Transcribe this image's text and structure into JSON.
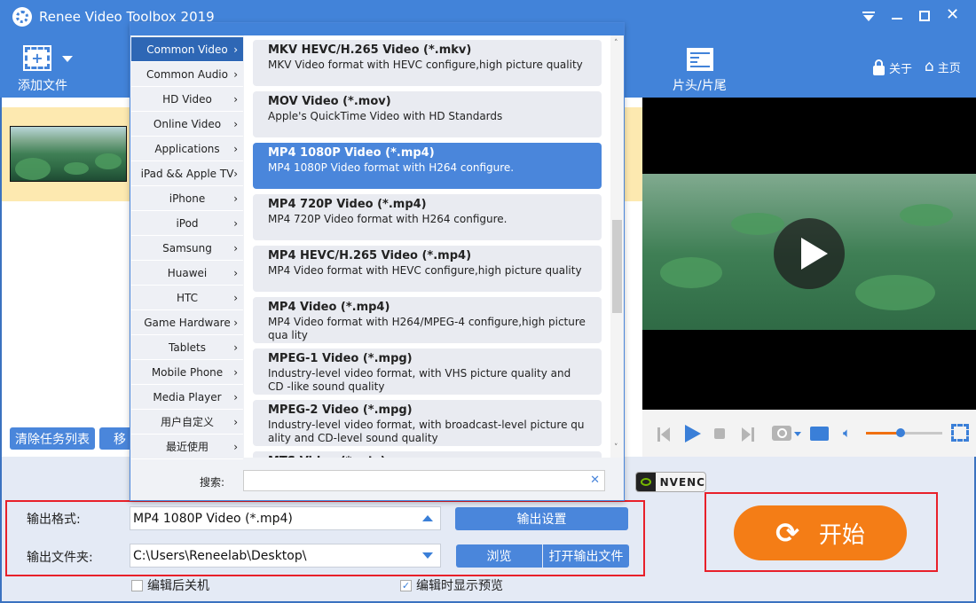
{
  "window": {
    "title": "Renee Video Toolbox 2019"
  },
  "toolbar": {
    "add_file": "添加文件",
    "head_tail": "片头/片尾",
    "about": "关于",
    "home": "主页"
  },
  "task_list": {
    "clear_button": "清除任务列表",
    "move_button": "移"
  },
  "format_popup": {
    "categories": [
      "Common Video",
      "Common Audio",
      "HD Video",
      "Online Video",
      "Applications",
      "iPad && Apple TV",
      "iPhone",
      "iPod",
      "Samsung",
      "Huawei",
      "HTC",
      "Game Hardware",
      "Tablets",
      "Mobile Phone",
      "Media Player",
      "用户自定义",
      "最近使用"
    ],
    "selected_category": "Common Video",
    "formats": [
      {
        "title": "MKV HEVC/H.265 Video (*.mkv)",
        "desc": "MKV Video format with HEVC configure,high picture quality"
      },
      {
        "title": "MOV Video (*.mov)",
        "desc": "Apple's QuickTime Video with HD Standards"
      },
      {
        "title": "MP4 1080P Video (*.mp4)",
        "desc": "MP4 1080P Video format with H264 configure."
      },
      {
        "title": "MP4 720P Video (*.mp4)",
        "desc": "MP4 720P Video format with H264 configure."
      },
      {
        "title": "MP4 HEVC/H.265 Video (*.mp4)",
        "desc": "MP4 Video format with HEVC configure,high picture quality"
      },
      {
        "title": "MP4 Video (*.mp4)",
        "desc": "MP4 Video format with H264/MPEG-4 configure,high picture qua lity"
      },
      {
        "title": "MPEG-1 Video (*.mpg)",
        "desc": "Industry-level video format, with VHS picture quality and CD -like sound quality"
      },
      {
        "title": "MPEG-2 Video (*.mpg)",
        "desc": "Industry-level video format, with broadcast-level picture qu ality and CD-level sound quality"
      },
      {
        "title": "MTS Video (*.mts)",
        "desc": ""
      }
    ],
    "selected_format": "MP4 1080P Video (*.mp4)",
    "search_label": "搜索:",
    "search_value": ""
  },
  "player": {
    "volume_percent": 45
  },
  "nvenc": "NVENC",
  "output": {
    "format_label": "输出格式:",
    "format_value": "MP4 1080P Video (*.mp4)",
    "settings_button": "输出设置",
    "folder_label": "输出文件夹:",
    "folder_value": "C:\\Users\\Reneelab\\Desktop\\",
    "browse_button": "浏览",
    "open_button": "打开输出文件"
  },
  "options": {
    "shutdown_label": "编辑后关机",
    "shutdown_checked": false,
    "preview_label": "编辑时显示预览",
    "preview_checked": true
  },
  "start_button": "开始",
  "colors": {
    "brand_blue": "#4283d9",
    "start_orange": "#f47d16",
    "highlight_red": "#e8202a"
  }
}
